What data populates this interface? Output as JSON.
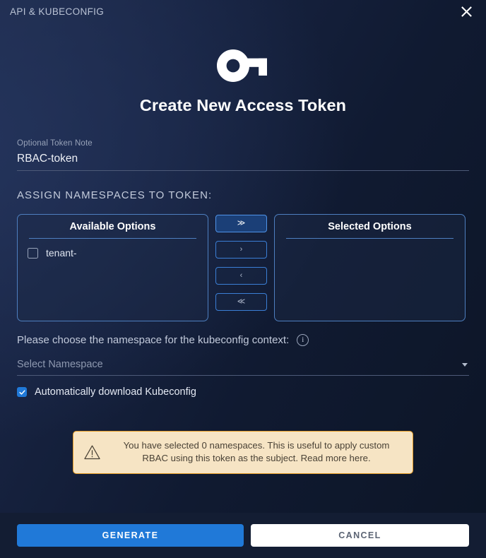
{
  "window": {
    "title": "API & KUBECONFIG",
    "close_icon": "close-icon"
  },
  "header": {
    "icon": "key-icon",
    "title": "Create New Access Token"
  },
  "token_note": {
    "label": "Optional Token Note",
    "value": "RBAC-token",
    "placeholder": ""
  },
  "assign": {
    "section_title": "ASSIGN NAMESPACES TO TOKEN:",
    "available": {
      "title": "Available Options",
      "items": [
        {
          "label": "tenant-",
          "redacted": true,
          "checked": false
        }
      ]
    },
    "selected": {
      "title": "Selected Options",
      "items": []
    },
    "transfer_buttons": [
      {
        "name": "move-all-right",
        "glyph": "≫",
        "active": true
      },
      {
        "name": "move-right",
        "glyph": "›",
        "active": false
      },
      {
        "name": "move-left",
        "glyph": "‹",
        "active": false
      },
      {
        "name": "move-all-left",
        "glyph": "≪",
        "active": false
      }
    ]
  },
  "namespace": {
    "prompt": "Please choose the namespace for the kubeconfig context:",
    "info_icon": "info-icon",
    "info_glyph": "i",
    "select_placeholder": "Select Namespace",
    "select_value": "Select Namespace",
    "auto_download_label": "Automatically download Kubeconfig",
    "auto_download_checked": true
  },
  "warning": {
    "icon": "warning-triangle-icon",
    "text": "You have selected 0 namespaces. This is useful to apply custom RBAC using this token as the subject. Read more here.",
    "selected_count": 0
  },
  "footer": {
    "generate_label": "GENERATE",
    "cancel_label": "CANCEL"
  },
  "colors": {
    "accent_blue": "#2079d8",
    "panel_border": "#4e7fc0",
    "warn_bg": "#f6e4c4",
    "warn_border": "#e49b23",
    "background_dark": "#0c1526",
    "background_light": "#1f2c4c"
  }
}
